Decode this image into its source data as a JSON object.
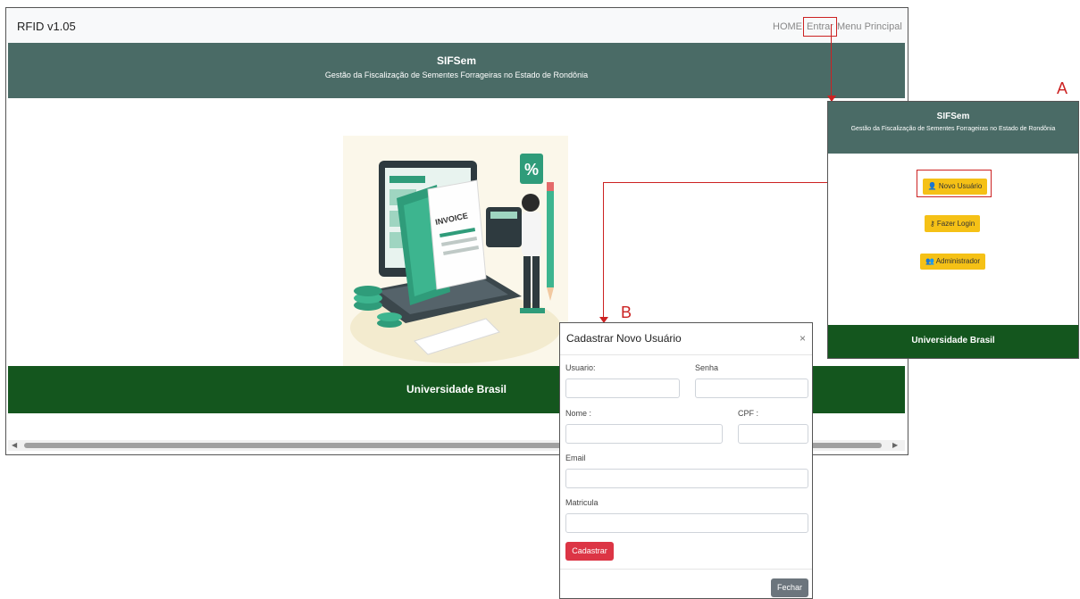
{
  "main": {
    "brand": "RFID v1.05",
    "nav": {
      "home": "HOME",
      "entrar": "Entrar",
      "menu": "Menu Principal"
    },
    "header": {
      "title": "SIFSem",
      "subtitle": "Gestão da Fiscalização de Sementes Forrageiras no Estado de Rondônia"
    },
    "illustration_text": {
      "invoice": "INVOICE",
      "percent": "%"
    },
    "footer": "Universidade Brasil",
    "scroll": {
      "left": "◀",
      "right": "▶"
    }
  },
  "panel_a": {
    "label": "A",
    "header": {
      "title": "SIFSem",
      "subtitle": "Gestão da Fiscalização de Sementes Forrageiras no Estado de Rondônia"
    },
    "buttons": {
      "novo": "Novo Usuário",
      "login": "Fazer Login",
      "admin": "Administrador"
    },
    "footer": "Universidade Brasil"
  },
  "panel_b": {
    "label": "B",
    "title": "Cadastrar Novo Usuário",
    "close": "×",
    "fields": {
      "usuario": "Usuario:",
      "senha": "Senha",
      "nome": "Nome :",
      "cpf": "CPF :",
      "email": "Email",
      "matricula": "Matricula"
    },
    "buttons": {
      "cadastrar": "Cadastrar",
      "fechar": "Fechar"
    }
  },
  "colors": {
    "header": "#4a6b66",
    "footer": "#14561e",
    "accent": "#f5c116",
    "danger": "#dc3545",
    "annotation": "#cc2222"
  }
}
